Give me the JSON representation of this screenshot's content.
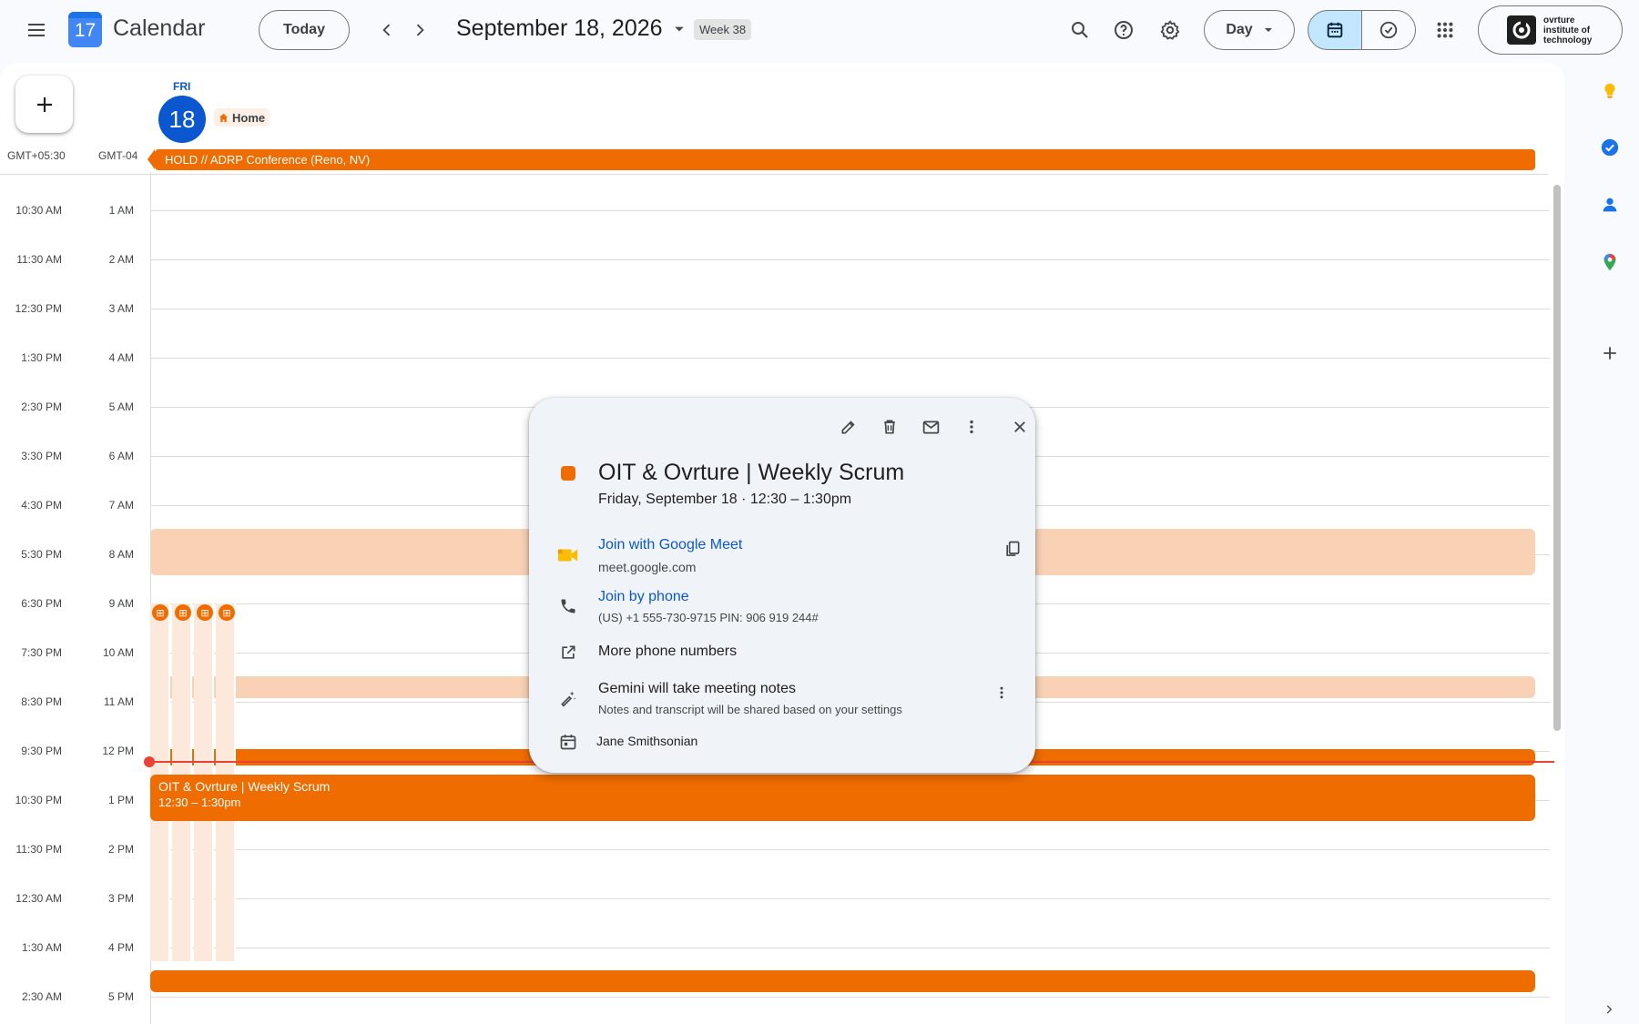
{
  "header": {
    "app_logo_day": "17",
    "app_name": "Calendar",
    "today_label": "Today",
    "date_title": "September 18, 2026",
    "week_badge": "Week 38",
    "view_label": "Day",
    "org_name": "ovrture institute of technology"
  },
  "day": {
    "name": "FRI",
    "number": "18",
    "location_chip": "Home"
  },
  "timezones": {
    "primary": "GMT+05:30",
    "secondary": "GMT-04"
  },
  "all_day_event": "HOLD // ADRP Conference (Reno, NV)",
  "time_rows": [
    {
      "left": "10:30 AM",
      "right": "1 AM"
    },
    {
      "left": "11:30 AM",
      "right": "2 AM"
    },
    {
      "left": "12:30 PM",
      "right": "3 AM"
    },
    {
      "left": "1:30 PM",
      "right": "4 AM"
    },
    {
      "left": "2:30 PM",
      "right": "5 AM"
    },
    {
      "left": "3:30 PM",
      "right": "6 AM"
    },
    {
      "left": "4:30 PM",
      "right": "7 AM"
    },
    {
      "left": "5:30 PM",
      "right": "8 AM"
    },
    {
      "left": "6:30 PM",
      "right": "9 AM"
    },
    {
      "left": "7:30 PM",
      "right": "10 AM"
    },
    {
      "left": "8:30 PM",
      "right": "11 AM"
    },
    {
      "left": "9:30 PM",
      "right": "12 PM"
    },
    {
      "left": "10:30 PM",
      "right": "1 PM"
    },
    {
      "left": "11:30 PM",
      "right": "2 PM"
    },
    {
      "left": "12:30 AM",
      "right": "3 PM"
    },
    {
      "left": "1:30 AM",
      "right": "4 PM"
    },
    {
      "left": "2:30 AM",
      "right": "5 PM"
    }
  ],
  "scrum_event": {
    "title": "OIT & Ovrture | Weekly Scrum",
    "time": "12:30 – 1:30pm"
  },
  "popover": {
    "title": "OIT & Ovrture | Weekly Scrum",
    "date_line": "Friday, September 18  ·  12:30 – 1:30pm",
    "meet_label": "Join with Google Meet",
    "meet_url": "meet.google.com",
    "phone_label": "Join by phone",
    "phone_details": "(US) +1 555-730-9715 PIN: 906 919 244#",
    "more_numbers": "More phone numbers",
    "gemini_title": "Gemini will take meeting notes",
    "gemini_sub": "Notes and transcript will be shared based on your settings",
    "organizer": "Jane Smithsonian"
  },
  "colors": {
    "accent": "#0b57d0",
    "event_orange": "#ef6c00",
    "event_light": "#f9d2b6",
    "now_line": "#ea4335"
  }
}
